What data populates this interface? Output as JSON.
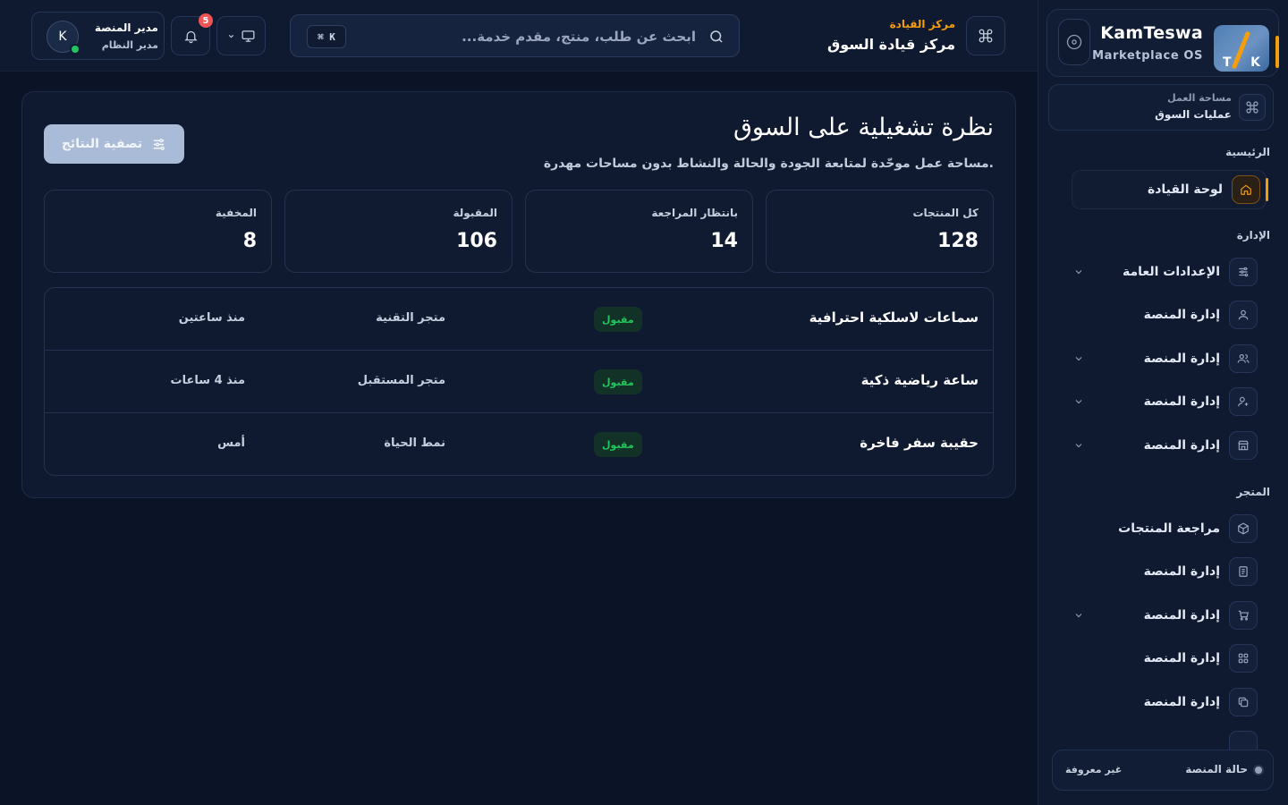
{
  "brand": {
    "name": "KamTeswa",
    "subtitle": "Marketplace OS",
    "logo_letter_left": "T",
    "logo_letter_right": "K"
  },
  "workspace": {
    "label": "مساحة العمل",
    "value": "عمليات السوق"
  },
  "sidebar": {
    "sections": [
      {
        "label": "الرئيسية",
        "items": [
          {
            "label": "لوحة القيادة",
            "icon": "home-icon",
            "active": true,
            "chevron": false
          }
        ]
      },
      {
        "label": "الإدارة",
        "items": [
          {
            "label": "الإعدادات العامة",
            "icon": "sliders-icon",
            "active": false,
            "chevron": true
          },
          {
            "label": "إدارة المنصة",
            "icon": "user-icon",
            "active": false,
            "chevron": false
          },
          {
            "label": "إدارة المنصة",
            "icon": "users-icon",
            "active": false,
            "chevron": true
          },
          {
            "label": "إدارة المنصة",
            "icon": "user-plus-icon",
            "active": false,
            "chevron": true
          },
          {
            "label": "إدارة المنصة",
            "icon": "store-icon",
            "active": false,
            "chevron": true
          }
        ]
      },
      {
        "label": "المتجر",
        "items": [
          {
            "label": "مراجعة المنتجات",
            "icon": "box-icon",
            "active": false,
            "chevron": false
          },
          {
            "label": "إدارة المنصة",
            "icon": "document-icon",
            "active": false,
            "chevron": false
          },
          {
            "label": "إدارة المنصة",
            "icon": "cart-icon",
            "active": false,
            "chevron": true
          },
          {
            "label": "إدارة المنصة",
            "icon": "grid-icon",
            "active": false,
            "chevron": false
          },
          {
            "label": "إدارة المنصة",
            "icon": "copy-icon",
            "active": false,
            "chevron": false
          }
        ]
      }
    ]
  },
  "platform_status": {
    "label": "حالة المنصة",
    "value": "غير معروفة"
  },
  "header": {
    "breadcrumb": "مركز القيادة",
    "title": "مركز قيادة السوق",
    "search_placeholder": "ابحث عن طلب، منتج، مقدم خدمة...",
    "search_value": "",
    "shortcut": "⌘ K",
    "notification_count": "5",
    "user": {
      "name": "مدير المنصة",
      "role": "مدير النظام",
      "initial": "K"
    }
  },
  "overview": {
    "title": "نظرة تشغيلية على السوق",
    "subtitle": "مساحة عمل موحّدة لمتابعة الجودة والحالة والنشاط بدون مساحات مهدرة.",
    "filter_label": "تصفية النتائج",
    "stats": [
      {
        "label": "كل المنتجات",
        "value": "128"
      },
      {
        "label": "بانتظار المراجعة",
        "value": "14"
      },
      {
        "label": "المقبولة",
        "value": "106"
      },
      {
        "label": "المخفية",
        "value": "8"
      }
    ],
    "rows": [
      {
        "name": "سماعات لاسلكية احترافية",
        "status": "مقبول",
        "store": "متجر التقنية",
        "time": "منذ ساعتين"
      },
      {
        "name": "ساعة رياضية ذكية",
        "status": "مقبول",
        "store": "متجر المستقبل",
        "time": "منذ 4 ساعات"
      },
      {
        "name": "حقيبة سفر فاخرة",
        "status": "مقبول",
        "store": "نمط الحياة",
        "time": "أمس"
      }
    ]
  },
  "colors": {
    "background": "#0b1326",
    "panel": "#0f1a30",
    "accent": "#f59e0b",
    "success": "#22c55e",
    "danger": "#ef5454",
    "filter_button": "#a9bbd6"
  }
}
